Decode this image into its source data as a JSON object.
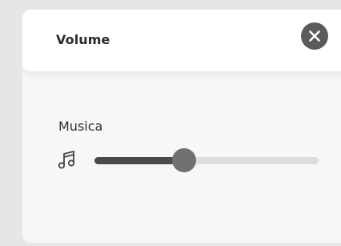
{
  "dialog": {
    "title": "Volume",
    "close_icon": "close-icon"
  },
  "volume": {
    "music_label": "Musica",
    "music_icon": "music-note-icon",
    "music_level": 0.4
  },
  "colors": {
    "track_fill": "#4a4a4a",
    "track_empty": "#dddddd",
    "thumb": "#707070",
    "close_button": "#5b5b5b"
  }
}
